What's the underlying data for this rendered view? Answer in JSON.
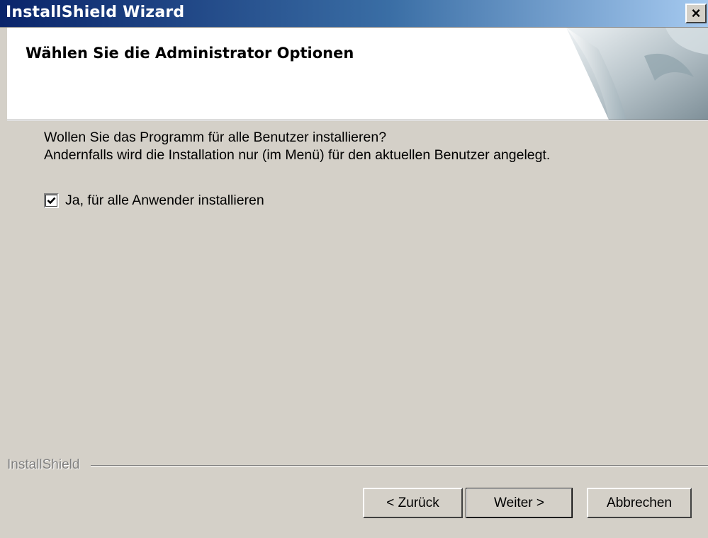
{
  "window": {
    "title": "InstallShield Wizard",
    "close_symbol": "×"
  },
  "header": {
    "title": "Wählen Sie die Administrator Optionen"
  },
  "content": {
    "description_line1": "Wollen Sie das Programm für alle Benutzer installieren?",
    "description_line2": "Andernfalls wird die Installation nur (im Menü) für den aktuellen Benutzer angelegt.",
    "checkbox": {
      "label": "Ja, für alle Anwender installieren",
      "checked": true
    }
  },
  "footer": {
    "brand": "InstallShield",
    "back_label": "< Zurück",
    "next_label": "Weiter >",
    "cancel_label": "Abbrechen"
  },
  "colors": {
    "titlebar_start": "#0a246a",
    "titlebar_end": "#a6caf0",
    "dialog_bg": "#d4d0c8"
  }
}
